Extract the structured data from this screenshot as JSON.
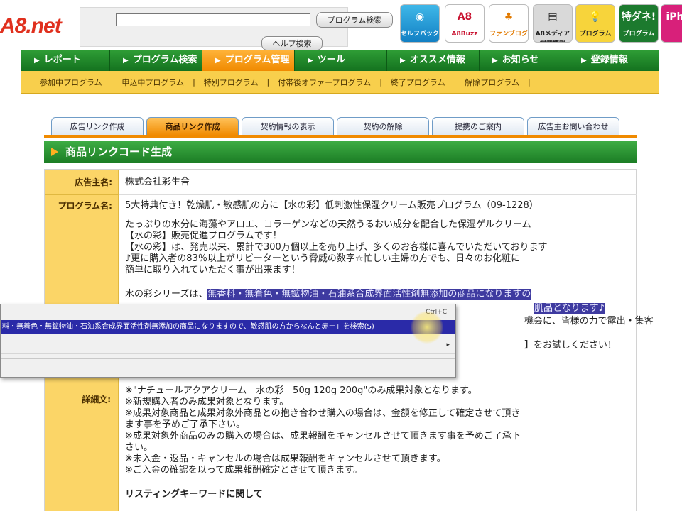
{
  "header": {
    "logo_text": "A8",
    "logo_suffix": ".net",
    "search_placeholder": "",
    "search_button": "プログラム検索",
    "help_button": "ヘルプ検索",
    "services": [
      {
        "label": "セルフバック",
        "icon": "self-back-icon"
      },
      {
        "label": "A8Buzz",
        "icon": "a8buzz-icon"
      },
      {
        "label": "ファンブログ",
        "icon": "fanblog-icon"
      },
      {
        "label": "A8メディア掲載情報",
        "icon": "media-icon"
      },
      {
        "label": "プログラム",
        "icon": "lightbulb-icon"
      },
      {
        "label": "プログラム",
        "icon": "tokudane-icon",
        "title": "特ダネ!"
      },
      {
        "label": "iPh",
        "icon": "iphone-icon"
      }
    ]
  },
  "nav": {
    "items": [
      {
        "label": "レポート"
      },
      {
        "label": "プログラム検索"
      },
      {
        "label": "プログラム管理"
      },
      {
        "label": "ツール"
      },
      {
        "label": "オススメ情報"
      },
      {
        "label": "お知らせ"
      },
      {
        "label": "登録情報"
      }
    ]
  },
  "subnav": {
    "items": [
      {
        "label": "参加中プログラム"
      },
      {
        "label": "申込中プログラム"
      },
      {
        "label": "特別プログラム"
      },
      {
        "label": "付帯後オファープログラム"
      },
      {
        "label": "終了プログラム"
      },
      {
        "label": "解除プログラム"
      }
    ],
    "separator": "|"
  },
  "tabs": [
    {
      "label": "広告リンク作成"
    },
    {
      "label": "商品リンク作成"
    },
    {
      "label": "契約情報の表示"
    },
    {
      "label": "契約の解除"
    },
    {
      "label": "提携のご案内"
    },
    {
      "label": "広告主お問い合わせ"
    }
  ],
  "section": {
    "title": "商品リンクコード生成"
  },
  "details": {
    "advertiser_label": "広告主名:",
    "advertiser_value": "株式会社彩生舎",
    "program_label": "プログラム名:",
    "program_value": "5大特典付き！乾燥肌・敏感肌の方に【水の彩】低刺激性保湿クリーム販売プログラム（09-1228）",
    "detail_label": "詳細文:",
    "text_lines": [
      "たっぷりの水分に海藻やアロエ、コラーゲンなどの天然うるおい成分を配合した保湿ゲルクリーム",
      "【水の彩】販売促進プログラムです！",
      "【水の彩】は、発売以来、累計で300万個以上を売り上げ、多くのお客様に喜んでいただいております",
      "♪更に購入者の83％以上がリピーターという脅威の数字☆忙しい主婦の方でも、日々のお化粧に",
      "簡単に取り入れていただく事が出来ます！"
    ],
    "series_prefix": "水の彩シリーズは、",
    "series_highlight": "無香料・無着色・無鉱物油・石油系合成界面活性剤無添加の商品になりますの",
    "partial_line_1": "肌品となります♪",
    "partial_line_2": "機会に、皆様の力で露出・集客",
    "partial_line_3": "】をお試しください！",
    "notes": [
      "※\"ナチュールアクアクリーム　水の彩　50g 120g 200g\"のみ成果対象となります。",
      "※新規購入者のみ成果対象となります。",
      "※成果対象商品と成果対象外商品との抱き合わせ購入の場合は、金額を修正して確定させて頂き",
      "ます事を予めご了承下さい。",
      "※成果対象外商品のみの購入の場合は、成果報酬をキャンセルさせて頂きます事を予めご了承下",
      "さい。",
      "※未入金・返品・キャンセルの場合は成果報酬をキャンセルさせて頂きます。",
      "※ご入金の確認を以って成果報酬確定とさせて頂きます。"
    ],
    "cut_line": "リスティングキーワードに関して"
  },
  "context_menu": {
    "shortcut": "Ctrl+C",
    "selected_item": "料・無着色・無鉱物油・石油系合成界面活性剤無添加の商品になりますので、敏感肌の方からなんと赤ー」を検索(S)",
    "arrow": "▸"
  }
}
